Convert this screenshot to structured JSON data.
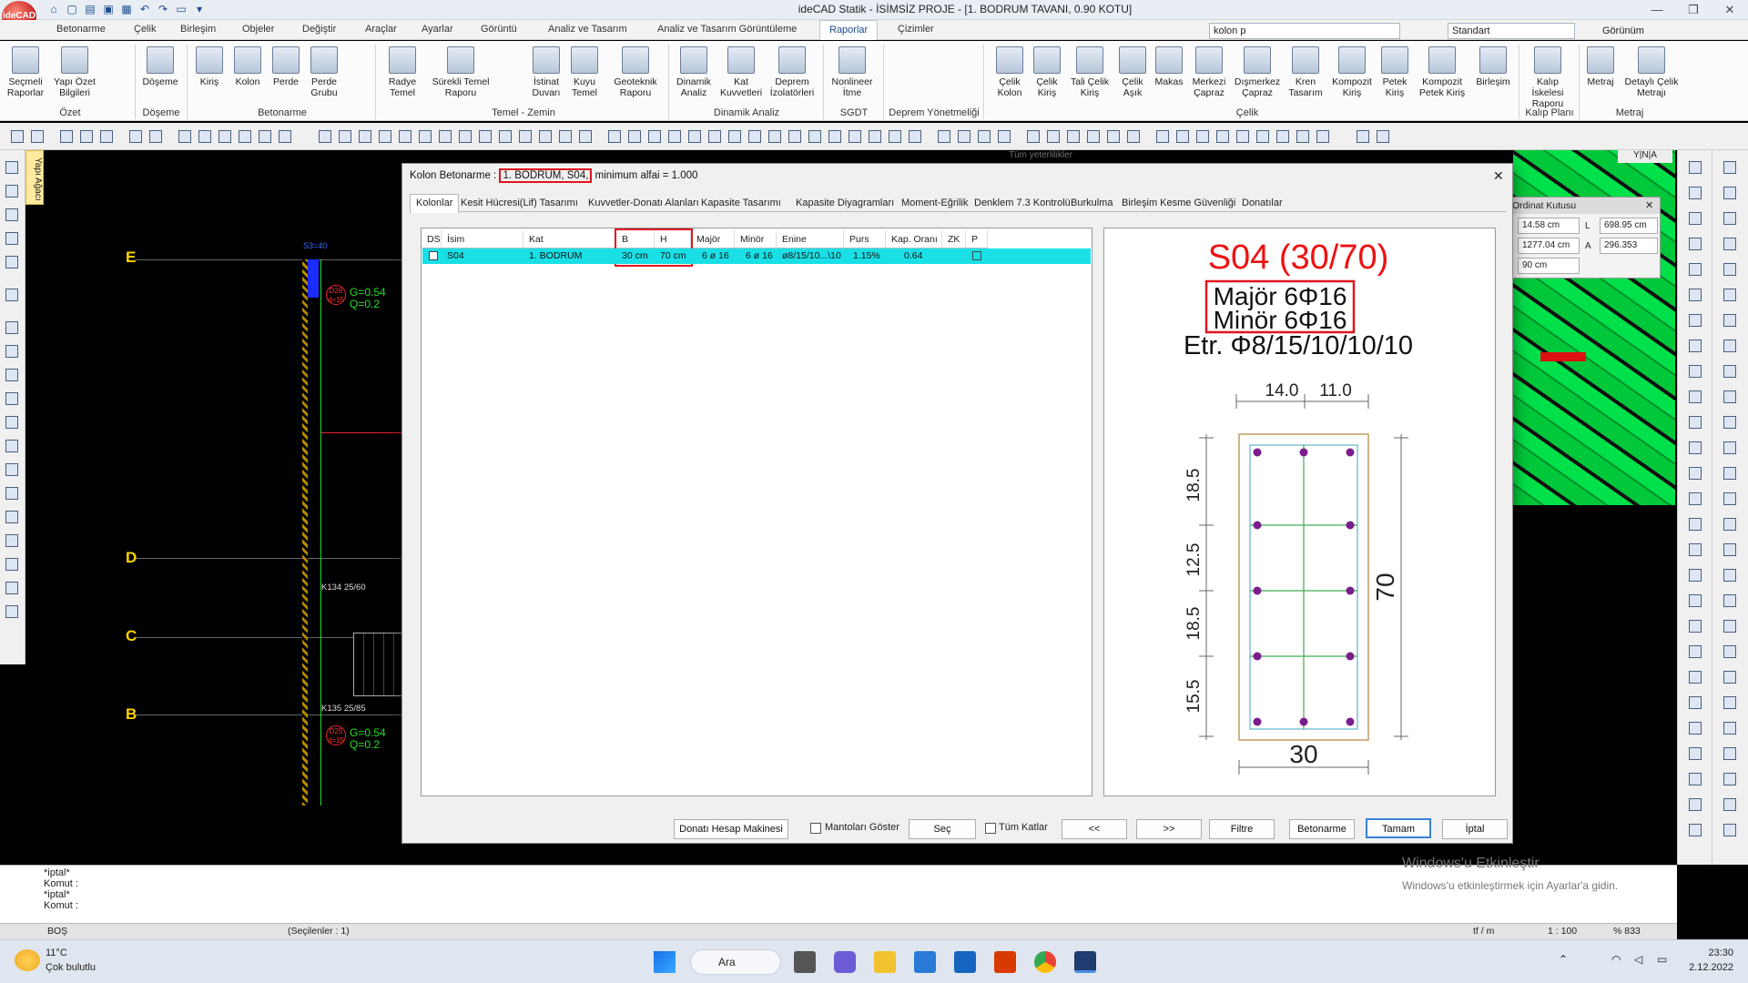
{
  "app": {
    "logo_text": "ideCAD",
    "window_title": "ideCAD Statik - İSİMSİZ PROJE - [1. BODRUM TAVANI,  0.90 KOTU]",
    "minimize": "—",
    "maximize": "❐",
    "close": "✕"
  },
  "menu": {
    "tabs": [
      "Betonarme",
      "Çelik",
      "Birleşim",
      "Objeler",
      "Değiştir",
      "Araçlar",
      "Ayarlar",
      "Görüntü",
      "Analiz ve Tasarım",
      "Analiz ve Tasarım Görüntüleme",
      "Raporlar",
      "Çizimler"
    ],
    "active_tab": "Raporlar",
    "search_value": "kolon p",
    "style_value": "Standart",
    "view_label": "Görünüm"
  },
  "ribbon": {
    "buttons": [
      {
        "label": "Seçmeli Raporlar"
      },
      {
        "label": "Yapı Özet Bilgileri"
      },
      {
        "label": "Döşeme"
      },
      {
        "label": "Kiriş"
      },
      {
        "label": "Kolon"
      },
      {
        "label": "Perde"
      },
      {
        "label": "Perde Grubu"
      },
      {
        "label": "Radye Temel"
      },
      {
        "label": "Sürekli Temel Raporu"
      },
      {
        "label": "İstinat Duvarı"
      },
      {
        "label": "Kuyu Temel"
      },
      {
        "label": "Geoteknik Raporu"
      },
      {
        "label": "Dinamik Analiz"
      },
      {
        "label": "Kat Kuvvetleri"
      },
      {
        "label": "Deprem İzolatörleri"
      },
      {
        "label": "Nonlineer İtme"
      },
      {
        "label": "Çelik Kolon"
      },
      {
        "label": "Çelik Kiriş"
      },
      {
        "label": "Tali Çelik Kiriş"
      },
      {
        "label": "Çelik Aşık"
      },
      {
        "label": "Makas"
      },
      {
        "label": "Merkezi Çapraz"
      },
      {
        "label": "Dışmerkez Çapraz"
      },
      {
        "label": "Kren Tasarım"
      },
      {
        "label": "Kompozit Kiriş"
      },
      {
        "label": "Petek Kiriş"
      },
      {
        "label": "Kompozit Petek Kiriş"
      },
      {
        "label": "Birleşim"
      },
      {
        "label": "Kalıp İskelesi Raporu"
      },
      {
        "label": "Metraj"
      },
      {
        "label": "Detaylı Çelik Metrajı"
      }
    ],
    "groups": [
      "Özet",
      "Döşeme",
      "Betonarme",
      "Temel - Zemin",
      "Dinamik Analiz",
      "SGDT",
      "Deprem Yönetmeliği",
      "Çelik",
      "Kalıp Planı",
      "Metraj"
    ]
  },
  "canvas": {
    "axes": [
      "E",
      "D",
      "C",
      "B"
    ],
    "labels": {
      "k134": "K134 25/60",
      "k135": "K135 25/85",
      "d26": "D26",
      "d26b": "d=15",
      "d26g": "G=0.54",
      "d26q": "Q=0.2",
      "d25": "D25",
      "d25b": "d=15",
      "d25g": "G=0.54",
      "d25q": "Q=0.2",
      "ref": "S3=40",
      "search_hint": "Tüm yeterlilikler"
    },
    "view_buttons": "Y|N|A"
  },
  "ordinat": {
    "title": "Ordinat Kutusu",
    "x": "14.58 cm",
    "l_label": "L",
    "l": "698.95 cm",
    "y": "1277.04 cm",
    "a_label": "A",
    "a": "296.353",
    "z": "90 cm"
  },
  "dialog": {
    "title_prefix": "Kolon Betonarme :",
    "title_highlight": "1. BODRUM, S04,",
    "title_suffix": "minimum alfai = 1.000",
    "close": "✕",
    "tabs": [
      "Kolonlar",
      "Kesit Hücresi(Lif) Tasarımı",
      "Kuvvetler-Donatı Alanları",
      "Kapasite Tasarımı",
      "Kapasite Diyagramları",
      "Moment-Eğrilik",
      "Denklem 7.3 Kontrolü",
      "Burkulma",
      "Birleşim Kesme Güvenliği",
      "Donatılar"
    ],
    "active_tab": "Kolonlar",
    "columns": [
      "DS",
      "İsim",
      "Kat",
      "B",
      "H",
      "Majör",
      "Minör",
      "Enine",
      "Purs",
      "Kap. Oranı",
      "ZK",
      "P"
    ],
    "row": {
      "isim": "S04",
      "kat": "1. BODRUM",
      "b": "30 cm",
      "h": "70 cm",
      "major": "6 ø 16",
      "minor": "6 ø 16",
      "enine": "ø8/15/10...\\10",
      "purs": "1.15%",
      "kap": "0.64"
    },
    "drawing": {
      "title": "S04 (30/70)",
      "major": "Majör 6Φ16",
      "minor": "Minör 6Φ16",
      "etr": "Etr. Φ8/15/10/10/10",
      "dim_top1": "14.0",
      "dim_top2": "11.0",
      "dim_left": [
        "18.5",
        "12.5",
        "18.5",
        "15.5"
      ],
      "dim_height": "70",
      "dim_width": "30"
    },
    "buttons": {
      "calc": "Donatı Hesap Makinesi",
      "mantolar": "Mantoları Göster",
      "sec": "Seç",
      "tumkatlar": "Tüm Katlar",
      "prev": "<<",
      "next": ">>",
      "filtre": "Filtre",
      "betonarme": "Betonarme",
      "tamam": "Tamam",
      "iptal": "İptal"
    }
  },
  "command": {
    "lines": [
      "*iptal*",
      "Komut :",
      "*iptal*",
      "Komut :"
    ]
  },
  "status": {
    "left": "BOŞ",
    "selected": "(Seçilenler : 1)",
    "unit": "tf / m",
    "scale": "1 : 100",
    "zoom": "% 833"
  },
  "watermark": {
    "line1": "Windows'u Etkinleştir",
    "line2": "Windows'u etkinleştirmek için Ayarlar'a gidin."
  },
  "taskbar": {
    "temp": "11°C",
    "weather": "Çok bulutlu",
    "search": "Ara",
    "time": "23:30",
    "date": "2.12.2022"
  }
}
